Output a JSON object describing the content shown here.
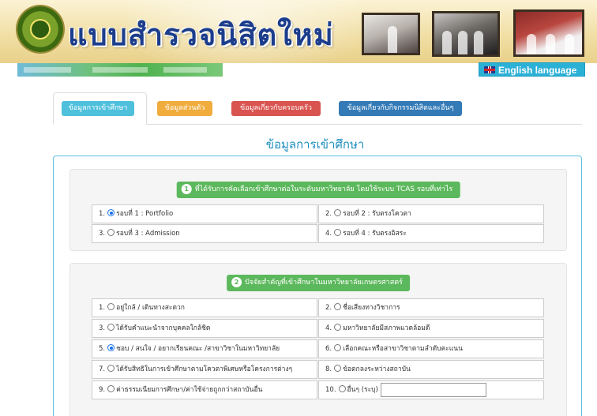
{
  "header": {
    "title": "แบบสำรวจนิสิตใหม่",
    "language_button": "English language"
  },
  "tabs": [
    {
      "label": "ข้อมูลการเข้าศึกษา",
      "color": "#4fc0dc",
      "active": true
    },
    {
      "label": "ข้อมูลส่วนตัว",
      "color": "#f0ad3e",
      "active": false
    },
    {
      "label": "ข้อมูลเกี่ยวกับครอบครัว",
      "color": "#d9534f",
      "active": false
    },
    {
      "label": "ข้อมูลเกี่ยวกับกิจกรรมนิสิตและอื่นๆ",
      "color": "#337ab7",
      "active": false
    }
  ],
  "section_title": "ข้อมูลการเข้าศึกษา",
  "question1": {
    "number": "1",
    "label": "ที่ได้รับการคัดเลือกเข้าศึกษาต่อในระดับมหาวิทยาลัย โดยใช้ระบบ TCAS รอบที่เท่าไร",
    "options": [
      {
        "num": "1.",
        "text": "รอบที่ 1 : Portfolio",
        "selected": true
      },
      {
        "num": "2.",
        "text": "รอบที่ 2 : รับตรงโควตา",
        "selected": false
      },
      {
        "num": "3.",
        "text": "รอบที่ 3 : Admission",
        "selected": false
      },
      {
        "num": "4.",
        "text": "รอบที่ 4 : รับตรงอิสระ",
        "selected": false
      }
    ]
  },
  "question2": {
    "number": "2",
    "label": "ปัจจัยสำคัญที่เข้าศึกษาในมหาวิทยาลัยเกษตรศาสตร์",
    "options": [
      {
        "num": "1.",
        "text": "อยู่ใกล้ / เดินทางสะดวก",
        "selected": false
      },
      {
        "num": "2.",
        "text": "ชื่อเสียงทางวิชาการ",
        "selected": false
      },
      {
        "num": "3.",
        "text": "ได้รับคำแนะนำจากบุคคลใกล้ชิด",
        "selected": false
      },
      {
        "num": "4.",
        "text": "มหาวิทยาลัยมีสภาพแวดล้อมดี",
        "selected": false
      },
      {
        "num": "5.",
        "text": "ชอบ / สนใจ / อยากเรียนคณะ /สาขาวิชาในมหาวิทยาลัย",
        "selected": true
      },
      {
        "num": "6.",
        "text": "เลือกคณะหรือสาขาวิชาตามลำดับคะแนน",
        "selected": false
      },
      {
        "num": "7.",
        "text": "ได้รับสิทธิในการเข้าศึกษาตามโควตาพิเศษหรือโครงการต่างๆ",
        "selected": false
      },
      {
        "num": "8.",
        "text": "ข้อตกลงระหว่างสถาบัน",
        "selected": false
      },
      {
        "num": "9.",
        "text": "ค่าธรรมเนียมการศึกษา/ค่าใช้จ่ายถูกกว่าสถาบันอื่น",
        "selected": false
      },
      {
        "num": "10.",
        "text": "อื่นๆ (ระบุ)",
        "selected": false
      }
    ],
    "other_value": ""
  }
}
